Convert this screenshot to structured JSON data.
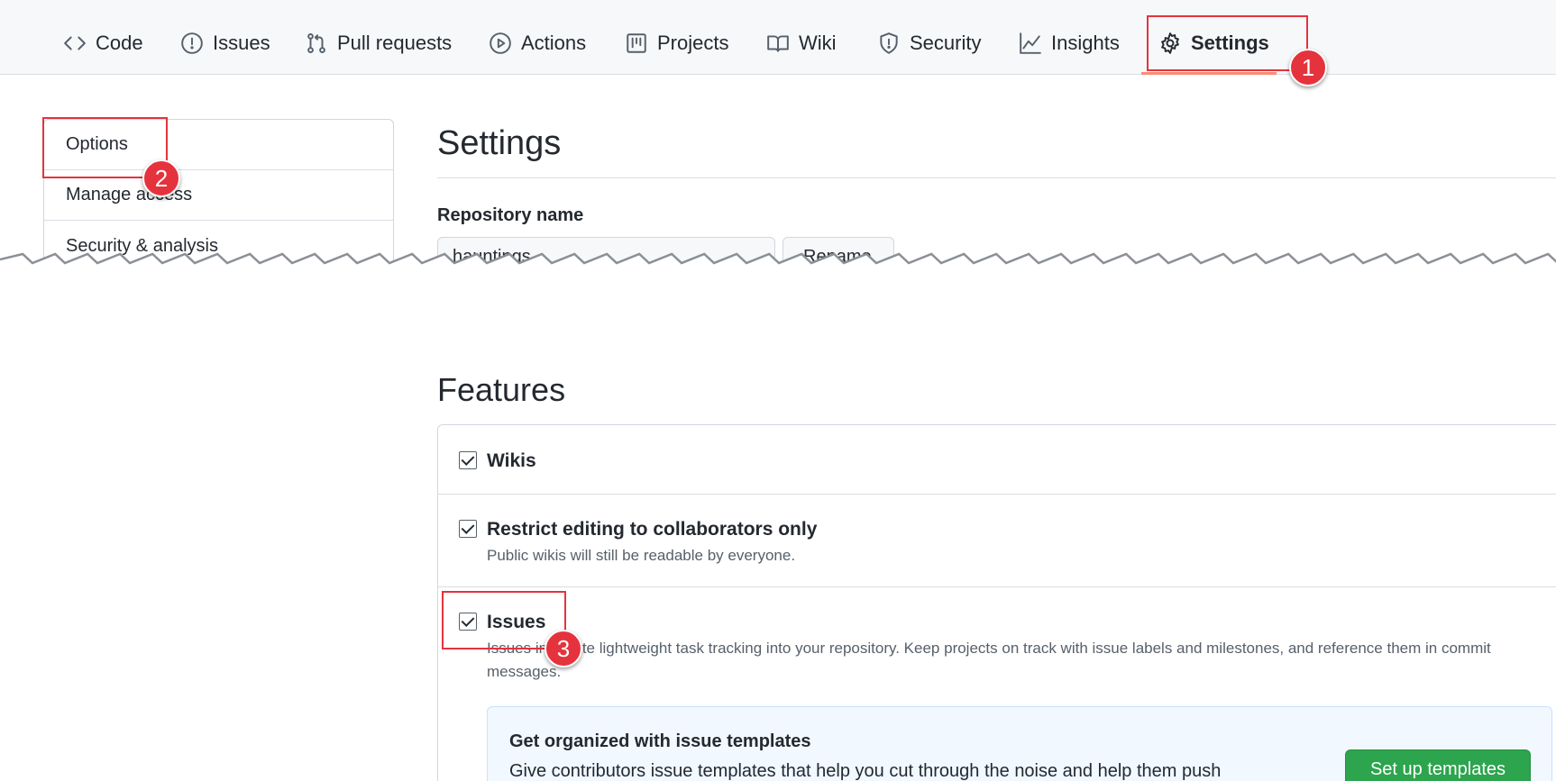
{
  "nav": {
    "tabs": [
      {
        "label": "Code",
        "icon": "code-icon"
      },
      {
        "label": "Issues",
        "icon": "issue-opened-icon"
      },
      {
        "label": "Pull requests",
        "icon": "git-pull-request-icon"
      },
      {
        "label": "Actions",
        "icon": "play-icon"
      },
      {
        "label": "Projects",
        "icon": "project-icon"
      },
      {
        "label": "Wiki",
        "icon": "book-icon"
      },
      {
        "label": "Security",
        "icon": "shield-icon"
      },
      {
        "label": "Insights",
        "icon": "graph-icon"
      },
      {
        "label": "Settings",
        "icon": "gear-icon"
      }
    ],
    "active_tab": "Settings"
  },
  "sidebar": {
    "items": [
      {
        "label": "Options"
      },
      {
        "label": "Manage access"
      },
      {
        "label": "Security & analysis"
      }
    ]
  },
  "settings": {
    "title": "Settings",
    "repo_label": "Repository name",
    "repo_value": "hauntings",
    "rename_label": "Rename"
  },
  "features": {
    "title": "Features",
    "items": [
      {
        "label": "Wikis",
        "checked": true,
        "note": ""
      },
      {
        "label": "Restrict editing to collaborators only",
        "checked": true,
        "note": "Public wikis will still be readable by everyone."
      },
      {
        "label": "Issues",
        "checked": true,
        "note": "Issues integrate lightweight task tracking into your repository. Keep projects on track with issue labels and milestones, and reference them in commit",
        "note2": "messages."
      }
    ],
    "template_callout": {
      "title": "Get organized with issue templates",
      "text": "Give contributors issue templates that help you cut through the noise and help them push",
      "button": "Set up templates"
    }
  },
  "callouts": [
    "1",
    "2",
    "3"
  ],
  "colors": {
    "callout_red": "#e5333d",
    "active_underline": "#fd8c73",
    "primary_button": "#2da44e",
    "nav_background": "#f6f8fa"
  }
}
